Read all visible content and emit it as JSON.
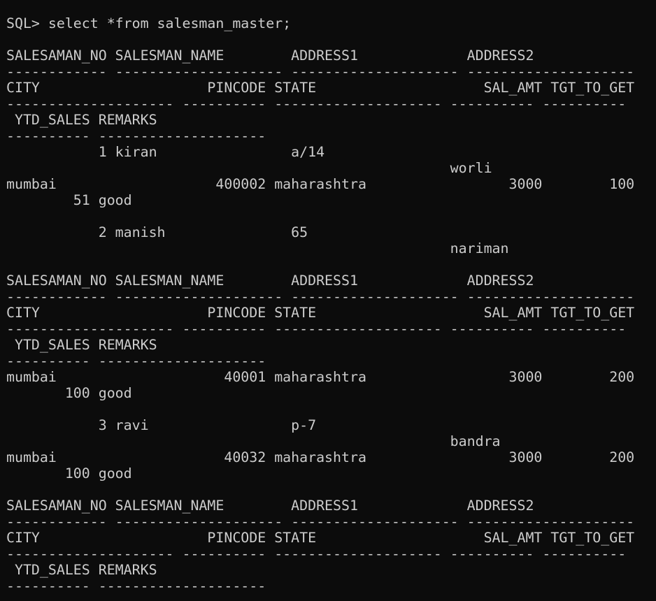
{
  "terminal": {
    "lines": [
      "SQL> select *from salesman_master;",
      "",
      "SALESAMAN_NO SALESMAN_NAME        ADDRESS1             ADDRESS2",
      "------------ -------------------- -------------------- --------------------",
      "CITY                    PINCODE STATE                    SAL_AMT TGT_TO_GET",
      "-------------------- ---------- -------------------- ---------- ----------",
      " YTD_SALES REMARKS",
      "---------- --------------------",
      "           1 kiran                a/14",
      "                                                     worli",
      "mumbai                   400002 maharashtra                 3000        100",
      "        51 good",
      "",
      "           2 manish               65",
      "                                                     nariman",
      "",
      "SALESAMAN_NO SALESMAN_NAME        ADDRESS1             ADDRESS2",
      "------------ -------------------- -------------------- --------------------",
      "CITY                    PINCODE STATE                    SAL_AMT TGT_TO_GET",
      "-------------------- ---------- -------------------- ---------- ----------",
      " YTD_SALES REMARKS",
      "---------- --------------------",
      "mumbai                    40001 maharashtra                 3000        200",
      "       100 good",
      "",
      "           3 ravi                 p-7",
      "                                                     bandra",
      "mumbai                    40032 maharashtra                 3000        200",
      "       100 good",
      "",
      "SALESAMAN_NO SALESMAN_NAME        ADDRESS1             ADDRESS2",
      "------------ -------------------- -------------------- --------------------",
      "CITY                    PINCODE STATE                    SAL_AMT TGT_TO_GET",
      "-------------------- ---------- -------------------- ---------- ----------",
      " YTD_SALES REMARKS",
      "---------- --------------------"
    ]
  },
  "colors": {
    "background": "#0c0c0c",
    "text": "#cccccc"
  }
}
